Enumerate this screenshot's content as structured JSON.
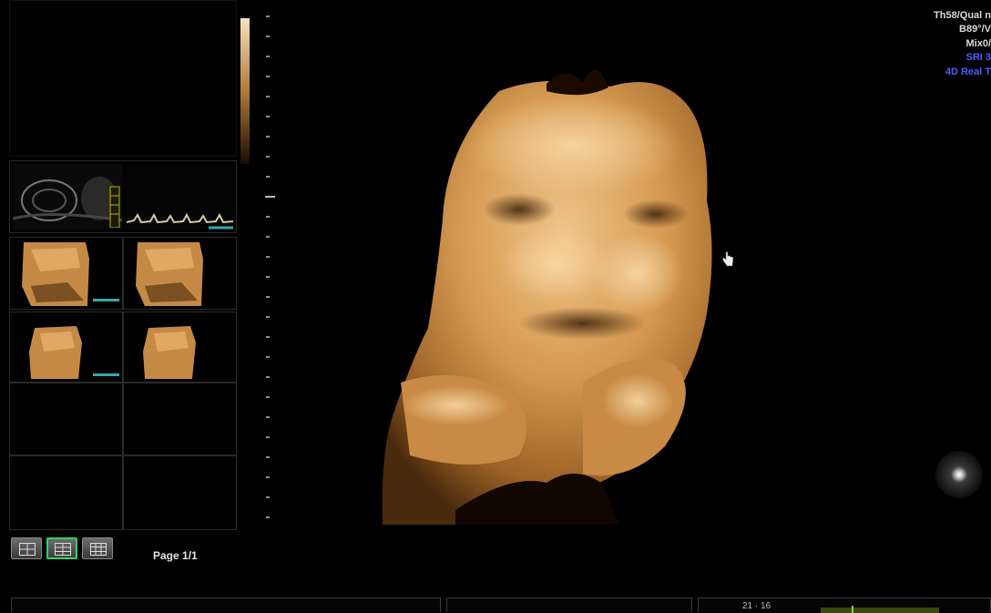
{
  "viewer": {
    "page_label": "Page 1/1",
    "layout_buttons": [
      {
        "name": "layout-2x2-button",
        "active": false
      },
      {
        "name": "layout-2x3-button",
        "active": true
      },
      {
        "name": "layout-3x3-button",
        "active": false
      }
    ]
  },
  "image_info": {
    "lines": [
      {
        "text": "Th58/Qual n",
        "color": "#d8d8d8"
      },
      {
        "text": "B89°/V",
        "color": "#d8d8d8"
      },
      {
        "text": "Mix0/",
        "color": "#d8d8d8"
      },
      {
        "text": "SRI 3",
        "color": "#4b5cff"
      },
      {
        "text": "4D Real T",
        "color": "#4b5cff"
      }
    ]
  },
  "bottom_bar": {
    "text": "21 · 16"
  },
  "colors": {
    "render_tone": "#d9a055",
    "accent_active": "#2ed26a",
    "blue_text": "#4b5cff",
    "thumb_marker": "#3aa6b0"
  }
}
